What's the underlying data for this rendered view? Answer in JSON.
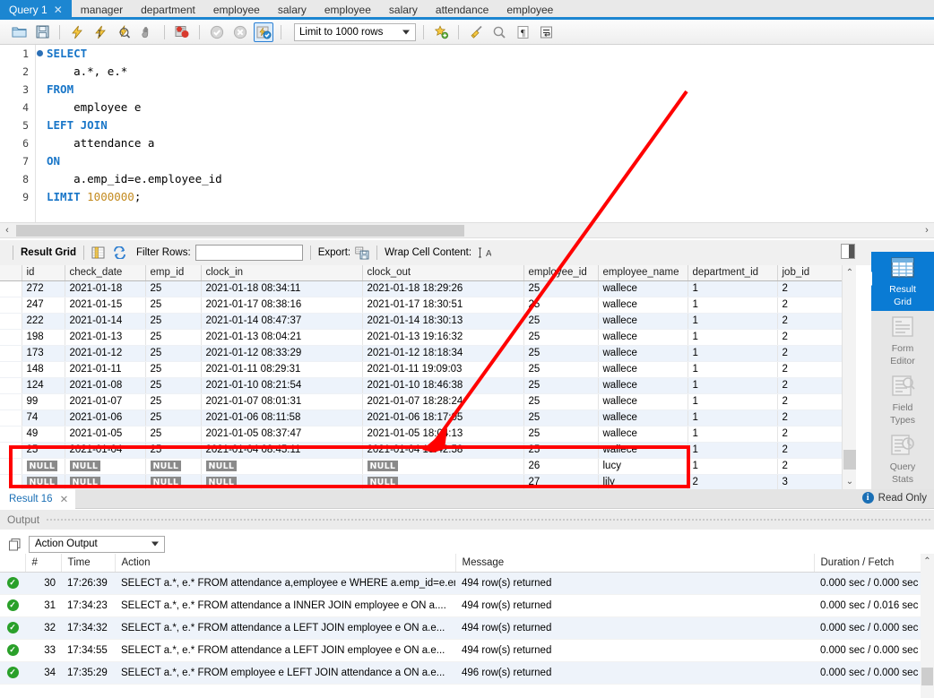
{
  "window": {
    "app": "MySQL Workbench SQL Editor"
  },
  "tabs": [
    {
      "label": "Query 1",
      "active": true,
      "closable": true
    },
    {
      "label": "manager",
      "active": false,
      "closable": false
    },
    {
      "label": "department",
      "active": false,
      "closable": false
    },
    {
      "label": "employee",
      "active": false,
      "closable": false
    },
    {
      "label": "salary",
      "active": false,
      "closable": false
    },
    {
      "label": "employee",
      "active": false,
      "closable": false
    },
    {
      "label": "salary",
      "active": false,
      "closable": false
    },
    {
      "label": "attendance",
      "active": false,
      "closable": false
    },
    {
      "label": "employee",
      "active": false,
      "closable": false
    }
  ],
  "toolbar": {
    "open_title": "Open SQL Script File",
    "save_title": "Save SQL Script to File",
    "execute_title": "Execute the selected portion of the script",
    "execute_current_title": "Execute the statement under the keyboard cursor",
    "explain_title": "Execute Explain for the statement under the cursor",
    "stop_title": "Stop the statement being executed",
    "toggle_title": "Toggle whether execution of SQL script should continue after failed statements",
    "commit_title": "Commit the current transaction",
    "rollback_title": "Rollback the current transaction",
    "autocommit_title": "Toggle Auto-Commit mode",
    "limit_label": "Limit to 1000 rows",
    "snippet_title": "Save current statement or selection to the snippet list",
    "beautify_title": "Beautify/reformat the SQL script",
    "find_title": "Find",
    "invisible_title": "Toggle invisible characters",
    "wrap_title": "Toggle wrapping of long lines"
  },
  "editor": {
    "lines": [
      {
        "n": "1",
        "breakpoint": true,
        "tokens": [
          {
            "t": "SELECT",
            "c": "kw"
          }
        ]
      },
      {
        "n": "2",
        "breakpoint": false,
        "tokens": [
          {
            "t": "    a.*, e.*",
            "c": "pl"
          }
        ]
      },
      {
        "n": "3",
        "breakpoint": false,
        "tokens": [
          {
            "t": "FROM",
            "c": "kw"
          }
        ]
      },
      {
        "n": "4",
        "breakpoint": false,
        "tokens": [
          {
            "t": "    employee e",
            "c": "pl"
          }
        ]
      },
      {
        "n": "5",
        "breakpoint": false,
        "tokens": [
          {
            "t": "LEFT JOIN",
            "c": "kw"
          }
        ]
      },
      {
        "n": "6",
        "breakpoint": false,
        "tokens": [
          {
            "t": "    attendance a",
            "c": "pl"
          }
        ]
      },
      {
        "n": "7",
        "breakpoint": false,
        "tokens": [
          {
            "t": "ON",
            "c": "kw"
          }
        ]
      },
      {
        "n": "8",
        "breakpoint": false,
        "tokens": [
          {
            "t": "    a.emp_id=e.employee_id",
            "c": "pl"
          }
        ]
      },
      {
        "n": "9",
        "breakpoint": false,
        "tokens": [
          {
            "t": "LIMIT ",
            "c": "kw"
          },
          {
            "t": "1000000",
            "c": "num"
          },
          {
            "t": ";",
            "c": "pl"
          }
        ]
      }
    ]
  },
  "result_grid_bar": {
    "title": "Result Grid",
    "filter_label": "Filter Rows:",
    "filter_value": "",
    "filter_placeholder": "",
    "export_label": "Export:",
    "wrap_label": "Wrap Cell Content:",
    "wrap_icon": "wrap-cell-icon",
    "grid_icon": "grid-columns-icon",
    "refresh_icon": "refresh-icon",
    "export_icon": "export-save-icon"
  },
  "grid": {
    "columns": [
      "id",
      "check_date",
      "emp_id",
      "clock_in",
      "clock_out",
      "employee_id",
      "employee_name",
      "department_id",
      "job_id"
    ],
    "rows": [
      {
        "id": "272",
        "check_date": "2021-01-18",
        "emp_id": "25",
        "clock_in": "2021-01-18 08:34:11",
        "clock_out": "2021-01-18 18:29:26",
        "employee_id": "25",
        "employee_name": "wallece",
        "department_id": "1",
        "job_id": "2",
        "null_row": false
      },
      {
        "id": "247",
        "check_date": "2021-01-15",
        "emp_id": "25",
        "clock_in": "2021-01-17 08:38:16",
        "clock_out": "2021-01-17 18:30:51",
        "employee_id": "25",
        "employee_name": "wallece",
        "department_id": "1",
        "job_id": "2",
        "null_row": false
      },
      {
        "id": "222",
        "check_date": "2021-01-14",
        "emp_id": "25",
        "clock_in": "2021-01-14 08:47:37",
        "clock_out": "2021-01-14 18:30:13",
        "employee_id": "25",
        "employee_name": "wallece",
        "department_id": "1",
        "job_id": "2",
        "null_row": false
      },
      {
        "id": "198",
        "check_date": "2021-01-13",
        "emp_id": "25",
        "clock_in": "2021-01-13 08:04:21",
        "clock_out": "2021-01-13 19:16:32",
        "employee_id": "25",
        "employee_name": "wallece",
        "department_id": "1",
        "job_id": "2",
        "null_row": false
      },
      {
        "id": "173",
        "check_date": "2021-01-12",
        "emp_id": "25",
        "clock_in": "2021-01-12 08:33:29",
        "clock_out": "2021-01-12 18:18:34",
        "employee_id": "25",
        "employee_name": "wallece",
        "department_id": "1",
        "job_id": "2",
        "null_row": false
      },
      {
        "id": "148",
        "check_date": "2021-01-11",
        "emp_id": "25",
        "clock_in": "2021-01-11 08:29:31",
        "clock_out": "2021-01-11 19:09:03",
        "employee_id": "25",
        "employee_name": "wallece",
        "department_id": "1",
        "job_id": "2",
        "null_row": false
      },
      {
        "id": "124",
        "check_date": "2021-01-08",
        "emp_id": "25",
        "clock_in": "2021-01-10 08:21:54",
        "clock_out": "2021-01-10 18:46:38",
        "employee_id": "25",
        "employee_name": "wallece",
        "department_id": "1",
        "job_id": "2",
        "null_row": false
      },
      {
        "id": "99",
        "check_date": "2021-01-07",
        "emp_id": "25",
        "clock_in": "2021-01-07 08:01:31",
        "clock_out": "2021-01-07 18:28:24",
        "employee_id": "25",
        "employee_name": "wallece",
        "department_id": "1",
        "job_id": "2",
        "null_row": false
      },
      {
        "id": "74",
        "check_date": "2021-01-06",
        "emp_id": "25",
        "clock_in": "2021-01-06 08:11:58",
        "clock_out": "2021-01-06 18:17:05",
        "employee_id": "25",
        "employee_name": "wallece",
        "department_id": "1",
        "job_id": "2",
        "null_row": false
      },
      {
        "id": "49",
        "check_date": "2021-01-05",
        "emp_id": "25",
        "clock_in": "2021-01-05 08:37:47",
        "clock_out": "2021-01-05 18:04:13",
        "employee_id": "25",
        "employee_name": "wallece",
        "department_id": "1",
        "job_id": "2",
        "null_row": false
      },
      {
        "id": "25",
        "check_date": "2021-01-04",
        "emp_id": "25",
        "clock_in": "2021-01-04 08:45:11",
        "clock_out": "2021-01-04 18:42:58",
        "employee_id": "25",
        "employee_name": "wallece",
        "department_id": "1",
        "job_id": "2",
        "null_row": false
      },
      {
        "id": "NULL",
        "check_date": "NULL",
        "emp_id": "NULL",
        "clock_in": "NULL",
        "clock_out": "NULL",
        "employee_id": "26",
        "employee_name": "lucy",
        "department_id": "1",
        "job_id": "2",
        "null_row": true
      },
      {
        "id": "NULL",
        "check_date": "NULL",
        "emp_id": "NULL",
        "clock_in": "NULL",
        "clock_out": "NULL",
        "employee_id": "27",
        "employee_name": "lily",
        "department_id": "2",
        "job_id": "3",
        "null_row": true
      }
    ],
    "null_text": "NULL"
  },
  "view_switcher": {
    "items": [
      {
        "label_line1": "Result",
        "label_line2": "Grid",
        "icon": "result-grid-icon",
        "active": true
      },
      {
        "label_line1": "Form",
        "label_line2": "Editor",
        "icon": "form-editor-icon",
        "active": false
      },
      {
        "label_line1": "Field",
        "label_line2": "Types",
        "icon": "field-types-icon",
        "active": false
      },
      {
        "label_line1": "Query",
        "label_line2": "Stats",
        "icon": "query-stats-icon",
        "active": false
      }
    ]
  },
  "result_tabs": {
    "tabs": [
      {
        "label": "Result 16",
        "active": true
      }
    ],
    "status": "Read Only",
    "status_icon": "info-icon"
  },
  "output": {
    "panel_title": "Output",
    "selector_value": "Action Output",
    "selector_icon": "output-pages-icon",
    "columns": [
      "#",
      "Time",
      "Action",
      "Message",
      "Duration / Fetch"
    ],
    "rows": [
      {
        "status": "ok",
        "num": "30",
        "time": "17:26:39",
        "action": "SELECT a.*, e.* FROM attendance a,employee e WHERE a.emp_id=e.employe...",
        "message": "494 row(s) returned",
        "duration": "0.000 sec / 0.000 sec"
      },
      {
        "status": "ok",
        "num": "31",
        "time": "17:34:23",
        "action": "SELECT     a.*, e.* FROM     attendance a INNER JOIN     employee e ON     a....",
        "message": "494 row(s) returned",
        "duration": "0.000 sec / 0.016 sec"
      },
      {
        "status": "ok",
        "num": "32",
        "time": "17:34:32",
        "action": "SELECT     a.*, e.* FROM     attendance a LEFT JOIN     employee e ON     a.e...",
        "message": "494 row(s) returned",
        "duration": "0.000 sec / 0.000 sec"
      },
      {
        "status": "ok",
        "num": "33",
        "time": "17:34:55",
        "action": "SELECT     a.*, e.* FROM     attendance a LEFT JOIN     employee e ON     a.e...",
        "message": "494 row(s) returned",
        "duration": "0.000 sec / 0.000 sec"
      },
      {
        "status": "ok",
        "num": "34",
        "time": "17:35:29",
        "action": "SELECT     a.*, e.* FROM     employee e LEFT JOIN     attendance a ON     a.e...",
        "message": "496 row(s) returned",
        "duration": "0.000 sec / 0.000 sec"
      }
    ]
  },
  "annotations": {
    "arrow_color": "#FF0000",
    "rect_color": "#FF0000"
  },
  "colors": {
    "accent": "#1c86d1",
    "keyword": "#1976c8",
    "number": "#c38a1e",
    "alt_row": "#edf3fb",
    "null_badge": "#8a8a8a",
    "ok_green": "#2aa02a"
  }
}
